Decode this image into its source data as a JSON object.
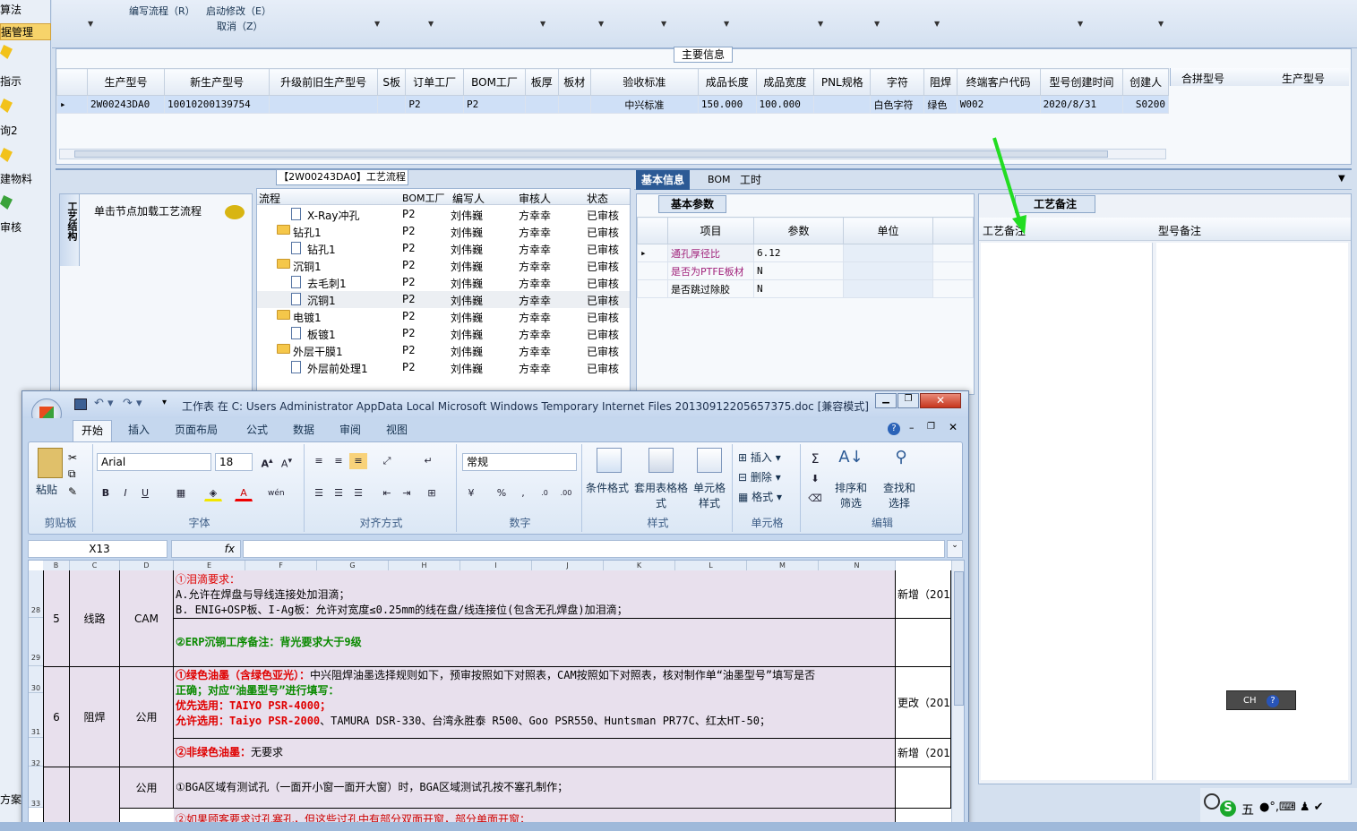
{
  "sidebar": {
    "items": [
      "算法",
      "据管理",
      "指示",
      "询2",
      "建物料",
      "审核",
      "方案"
    ]
  },
  "toolbar": {
    "edit_flow": "编写流程（R）",
    "start_modify": "启动修改（E）",
    "cancel": "取消（Z）"
  },
  "main_info": {
    "title": "主要信息",
    "columns": [
      "生产型号",
      "新生产型号",
      "升级前旧生产型号",
      "S板",
      "订单工厂",
      "BOM工厂",
      "板厚",
      "板材",
      "验收标准",
      "成品长度",
      "成品宽度",
      "PNL规格",
      "字符",
      "阻焊",
      "终端客户代码",
      "型号创建时间",
      "创建人"
    ],
    "row": {
      "production_model": "2W00243DA0",
      "new_model": "10010200139754",
      "order_factory": "P2",
      "bom_factory": "P2",
      "standard": "中兴标准",
      "length": "150.000",
      "width": "100.000",
      "char": "白色字符",
      "solder": "绿色",
      "customer": "W002",
      "created": "2020/8/31",
      "extra": "S0200"
    },
    "side_columns": [
      "合拼型号",
      "生产型号"
    ]
  },
  "process": {
    "title": "【2W00243DA0】工艺流程",
    "side_tab": "工艺结构",
    "hint": "单击节点加载工艺流程",
    "columns": [
      "流程",
      "BOM工厂",
      "编写人",
      "审核人",
      "状态"
    ],
    "rows": [
      {
        "name": "X-Ray冲孔",
        "type": "doc",
        "indent": 1,
        "bom": "P2",
        "writer": "刘伟巍",
        "reviewer": "方幸幸",
        "status": "已审核"
      },
      {
        "name": "钻孔1",
        "type": "folder",
        "indent": 0,
        "bom": "P2",
        "writer": "刘伟巍",
        "reviewer": "方幸幸",
        "status": "已审核"
      },
      {
        "name": "钻孔1",
        "type": "doc",
        "indent": 1,
        "bom": "P2",
        "writer": "刘伟巍",
        "reviewer": "方幸幸",
        "status": "已审核"
      },
      {
        "name": "沉铜1",
        "type": "folder",
        "indent": 0,
        "bom": "P2",
        "writer": "刘伟巍",
        "reviewer": "方幸幸",
        "status": "已审核"
      },
      {
        "name": "去毛刺1",
        "type": "doc",
        "indent": 1,
        "bom": "P2",
        "writer": "刘伟巍",
        "reviewer": "方幸幸",
        "status": "已审核"
      },
      {
        "name": "沉铜1",
        "type": "doc",
        "indent": 1,
        "bom": "P2",
        "writer": "刘伟巍",
        "reviewer": "方幸幸",
        "status": "已审核"
      },
      {
        "name": "电镀1",
        "type": "folder",
        "indent": 0,
        "bom": "P2",
        "writer": "刘伟巍",
        "reviewer": "方幸幸",
        "status": "已审核"
      },
      {
        "name": "板镀1",
        "type": "doc",
        "indent": 1,
        "bom": "P2",
        "writer": "刘伟巍",
        "reviewer": "方幸幸",
        "status": "已审核"
      },
      {
        "name": "外层干膜1",
        "type": "folder",
        "indent": 0,
        "bom": "P2",
        "writer": "刘伟巍",
        "reviewer": "方幸幸",
        "status": "已审核"
      },
      {
        "name": "外层前处理1",
        "type": "doc",
        "indent": 1,
        "bom": "P2",
        "writer": "刘伟巍",
        "reviewer": "方幸幸",
        "status": "已审核"
      }
    ]
  },
  "detail_tabs": [
    "基本信息",
    "BOM",
    "工时"
  ],
  "basic_params": {
    "tab": "基本参数",
    "columns": [
      "项目",
      "参数",
      "单位"
    ],
    "rows": [
      {
        "item": "通孔厚径比",
        "value": "6.12",
        "unit": ""
      },
      {
        "item": "是否为PTFE板材",
        "value": "N",
        "unit": ""
      },
      {
        "item": "是否跳过除胶",
        "value": "N",
        "unit": ""
      }
    ]
  },
  "remarks": {
    "tab": "工艺备注",
    "col1": "工艺备注",
    "col2": "型号备注"
  },
  "excel": {
    "title": "工作表 在 C: Users Administrator AppData Local Microsoft Windows Temporary Internet Files 20130912205657375.doc  [兼容模式] ...",
    "tabs": [
      "开始",
      "插入",
      "页面布局",
      "公式",
      "数据",
      "审阅",
      "视图"
    ],
    "font": "Arial",
    "size": "18",
    "format": "常规",
    "cellref": "X13",
    "fx": "fx",
    "groups": {
      "clipboard": "剪贴板",
      "font": "字体",
      "align": "对齐方式",
      "number": "数字",
      "style": "样式",
      "cells": "单元格",
      "edit": "编辑"
    },
    "buttons": {
      "paste": "粘贴",
      "cond": "条件格式",
      "table": "套用表格格式",
      "cellstyle": "单元格样式",
      "insert": "插入",
      "delete": "删除",
      "format": "格式",
      "sort": "排序和筛选",
      "find": "查找和选择"
    },
    "col_headers": [
      "B",
      "C",
      "D",
      "E",
      "F",
      "G",
      "H",
      "I",
      "J",
      "K",
      "L",
      "M",
      "N"
    ],
    "row_numbers": [
      "28",
      "29",
      "30",
      "31",
      "32",
      "33"
    ],
    "rows": [
      {
        "no": "5",
        "cat": "线路",
        "dept": "CAM"
      },
      {
        "no": "6",
        "cat": "阻焊",
        "dept": "公用"
      },
      {
        "no": "",
        "cat": "",
        "dept": "公用"
      }
    ],
    "text": {
      "l1": "①泪滴要求：",
      "l2": "A.允许在焊盘与导线连接处加泪滴；",
      "l3": "B. ENIG+OSP板、I-Ag板：允许对宽度≤0.25mm的线在盘/线连接位(包含无孔焊盘)加泪滴；",
      "l4": "②ERP沉铜工序备注：背光要求大于9级",
      "l5a": "①绿色油墨（含绿色亚光）：",
      "l5b": "中兴阻焊油墨选择规则如下，预审按照如下对照表，CAM按照如下对照表，核对制作单“油墨型号”填写是否",
      "l6a": "正确；",
      "l6b": "对应“油墨型号”进行填写：",
      "l7a": "优先选用：",
      "l7b": "TAIYO PSR-4000；",
      "l8a": "允许选用：",
      "l8b": "Taiyo PSR-2000",
      "l8c": "、TAMURA DSR-330、台湾永胜泰 R500、Goo PSR550、Huntsman PR77C、红太HT-50；",
      "l9a": "②非绿色油墨：",
      "l9b": "无要求",
      "l10": "①BGA区域有测试孔（一面开小窗一面开大窗）时，BGA区域测试孔按不塞孔制作；",
      "l11": "②如果顾客要求过孔塞孔，但这些过孔中有部分双面开窗，部分单面开窗；"
    },
    "side_notes": [
      "新增（201",
      "更改（201",
      "新增（201"
    ]
  },
  "ime": {
    "label": "CH",
    "wubi": "五"
  }
}
